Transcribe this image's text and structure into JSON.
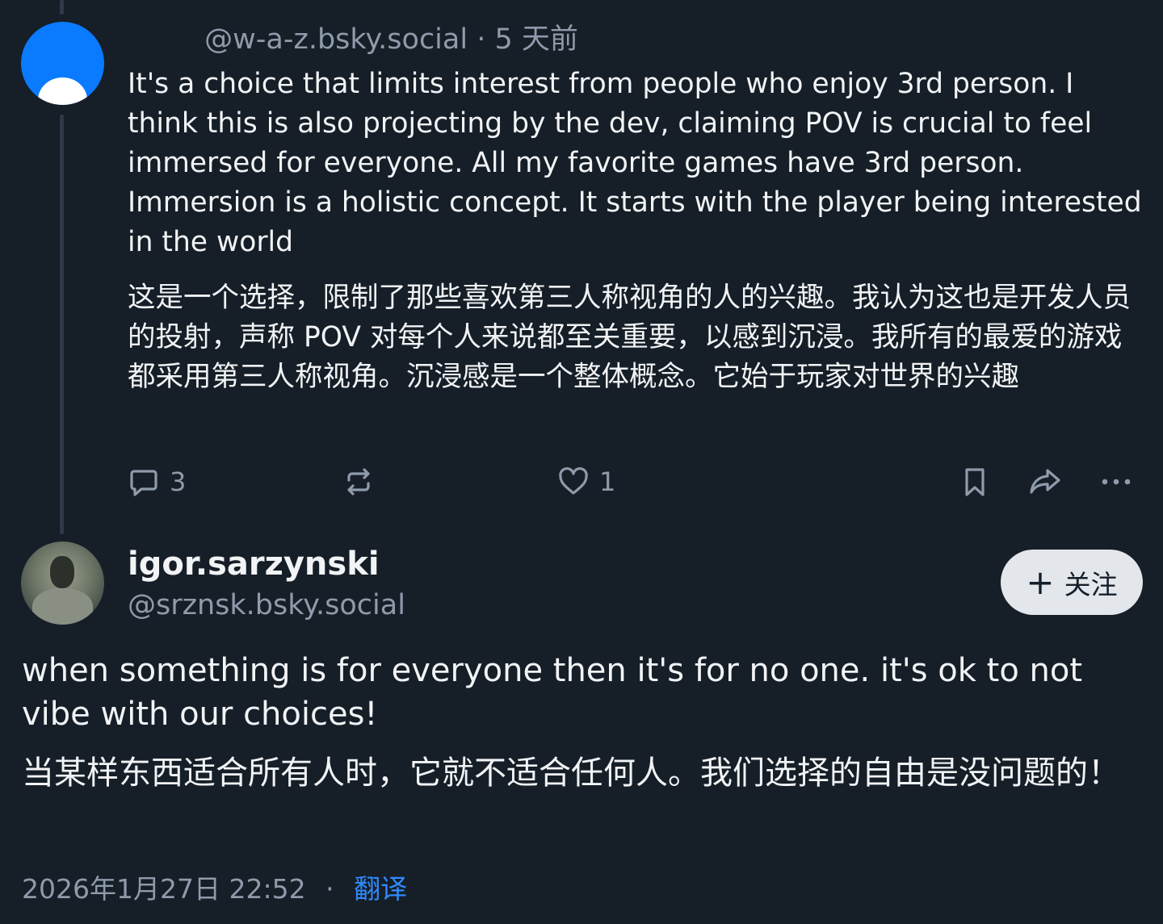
{
  "parent_post": {
    "handle": "@w-a-z.bsky.social",
    "separator": "·",
    "time_ago": "5 天前",
    "text_en": "It's a choice that limits interest from people who enjoy 3rd person. I think this is also projecting by the dev, claiming POV is crucial to feel immersed for everyone. All my favorite games have 3rd person. Immersion is a holistic concept. It starts with the player being interested in the world",
    "text_zh": "这是一个选择，限制了那些喜欢第三人称视角的人的兴趣。我认为这也是开发人员的投射，声称 POV 对每个人来说都至关重要，以感到沉浸。我所有的最爱的游戏都采用第三人称视角。沉浸感是一个整体概念。它始于玩家对世界的兴趣",
    "actions": {
      "reply_icon": "reply-bubble-icon",
      "reply_count": "3",
      "repost_icon": "repost-icon",
      "like_icon": "heart-icon",
      "like_count": "1",
      "bookmark_icon": "bookmark-icon",
      "share_icon": "share-icon",
      "more_icon": "more-dots-icon"
    }
  },
  "main_post": {
    "display_name": "igor.sarzynski",
    "handle": "@srznsk.bsky.social",
    "follow_label": "关注",
    "follow_icon": "plus-icon",
    "text_en": "when something is for everyone then it's for no one. it's ok to not vibe with our choices!",
    "text_zh": "当某样东西适合所有人时，它就不适合任何人。我们选择的自由是没问题的！",
    "timestamp": "2026年1月27日 22:52",
    "separator": "·",
    "translate_label": "翻译"
  },
  "colors": {
    "background": "#161e27",
    "text_primary": "#f1f3f5",
    "text_secondary": "#8e9bab",
    "link": "#2f8bff",
    "avatar_default": "#0a7aff",
    "follow_button_bg": "#e3e7ec"
  }
}
